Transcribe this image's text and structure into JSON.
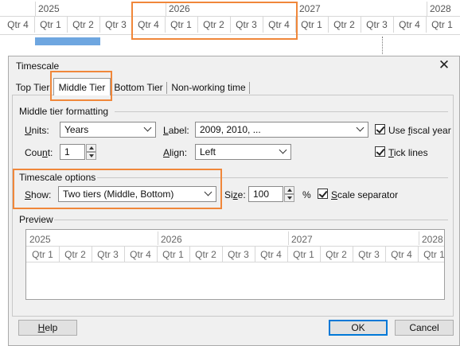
{
  "background_timescale": {
    "years": [
      "2025",
      "2026",
      "2027",
      "2028"
    ],
    "quarters": [
      "Qtr 4",
      "Qtr 1",
      "Qtr 2",
      "Qtr 3",
      "Qtr 4",
      "Qtr 1",
      "Qtr 2",
      "Qtr 3",
      "Qtr 4",
      "Qtr 1",
      "Qtr 2",
      "Qtr 3",
      "Qtr 4",
      "Qtr 1"
    ]
  },
  "dialog": {
    "title": "Timescale",
    "close_icon": "close-icon",
    "tabs": [
      {
        "label": "Top Tier",
        "active": false
      },
      {
        "label": "Middle Tier",
        "active": true
      },
      {
        "label": "Bottom Tier",
        "active": false
      },
      {
        "label": "Non-working time",
        "active": false
      }
    ],
    "middle_tier_formatting": {
      "heading": "Middle tier formatting",
      "units_label": "Units:",
      "units_value": "Years",
      "label_label": "Label:",
      "label_value": "2009, 2010, ...",
      "use_fiscal_year_label": "Use fiscal year",
      "use_fiscal_year_checked": true,
      "count_label": "Count:",
      "count_value": "1",
      "align_label": "Align:",
      "align_value": "Left",
      "tick_lines_label": "Tick lines",
      "tick_lines_checked": true
    },
    "timescale_options": {
      "heading": "Timescale options",
      "show_label": "Show:",
      "show_value": "Two tiers (Middle, Bottom)",
      "size_label": "Size:",
      "size_value": "100",
      "size_unit": "%",
      "scale_separator_label": "Scale separator",
      "scale_separator_checked": true
    },
    "preview": {
      "heading": "Preview",
      "years": [
        "2025",
        "2026",
        "2027",
        "2028"
      ],
      "quarters": [
        "Qtr 1",
        "Qtr 2",
        "Qtr 3",
        "Qtr 4",
        "Qtr 1",
        "Qtr 2",
        "Qtr 3",
        "Qtr 4",
        "Qtr 1",
        "Qtr 2",
        "Qtr 3",
        "Qtr 4",
        "Qtr 1"
      ]
    },
    "buttons": {
      "help": "Help",
      "ok": "OK",
      "cancel": "Cancel"
    }
  },
  "colors": {
    "highlight": "#f0873a",
    "gantt_bar": "#6ea6e0",
    "ok_border": "#0078d7"
  }
}
